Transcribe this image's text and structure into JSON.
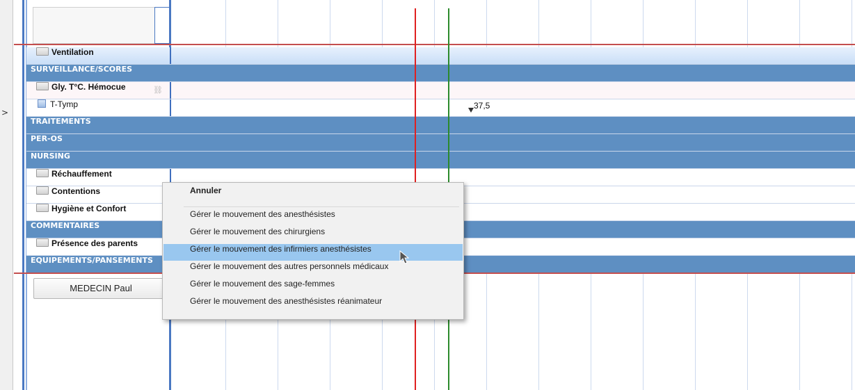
{
  "rows": [
    {
      "label": "Ventilation",
      "kind": "folder"
    },
    {
      "label": "SURVEILLANCE/SCORES",
      "kind": "section"
    },
    {
      "label": "Gly. T°C. Hémocue",
      "kind": "folder"
    },
    {
      "label": "T-Tymp",
      "kind": "item",
      "value": "37,5"
    },
    {
      "label": "TRAITEMENTS",
      "kind": "section"
    },
    {
      "label": "PER-OS",
      "kind": "section"
    },
    {
      "label": "NURSING",
      "kind": "section"
    },
    {
      "label": "Réchauffement",
      "kind": "folder"
    },
    {
      "label": "Contentions",
      "kind": "folder"
    },
    {
      "label": "Hygiène et Confort",
      "kind": "folder"
    },
    {
      "label": "COMMENTAIRES",
      "kind": "section"
    },
    {
      "label": "Présence des parents",
      "kind": "folder"
    },
    {
      "label": "EQUIPEMENTS/PANSEMENTS",
      "kind": "section"
    }
  ],
  "expander": ">",
  "bottom_button": "MEDECIN Paul",
  "context_menu": {
    "items": [
      "Annuler",
      "Gérer le mouvement des anesthésistes",
      "Gérer le mouvement des chirurgiens",
      "Gérer le mouvement des infirmiers anesthésistes",
      "Gérer le mouvement des autres personnels médicaux",
      "Gérer le mouvement des sage-femmes",
      "Gérer le mouvement des anesthésistes réanimateur"
    ],
    "highlighted_index": 3
  },
  "colors": {
    "section_band": "#5e8fc2",
    "red_line": "#e02020",
    "green_line": "#2c8a2c",
    "menu_highlight": "#99c7ef"
  }
}
